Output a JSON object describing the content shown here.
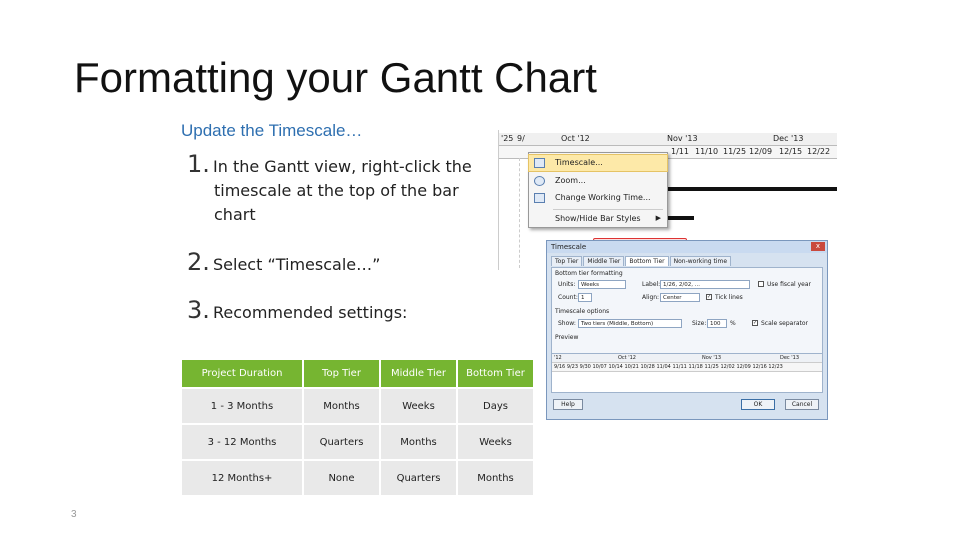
{
  "title": "Formatting your Gantt Chart",
  "subtitle": "Update the Timescale…",
  "steps": [
    {
      "num": "1.",
      "line1": "In the Gantt view, right-click the",
      "line2": "timescale at the top of the bar",
      "line3": "chart"
    },
    {
      "num": "2.",
      "line1": "Select “Timescale…”"
    },
    {
      "num": "3.",
      "line1": "Recommended settings:"
    }
  ],
  "table": {
    "headers": [
      "Project Duration",
      "Top Tier",
      "Middle Tier",
      "Bottom Tier"
    ],
    "rows": [
      [
        "1 - 3 Months",
        "Months",
        "Weeks",
        "Days"
      ],
      [
        "3 -  12 Months",
        "Quarters",
        "Months",
        "Weeks"
      ],
      [
        "12 Months+",
        "None",
        "Quarters",
        "Months"
      ]
    ]
  },
  "page_number": "3",
  "gantt": {
    "top_row": [
      "'25",
      "9/",
      "Oct '12",
      "Nov '13",
      "Dec '13"
    ],
    "bottom_row": [
      "1/11",
      "11/10",
      "11/25",
      "12/09",
      "12/15",
      "12/22"
    ]
  },
  "context_menu": {
    "items": [
      {
        "label": "Timescale...",
        "icon": "timescale-icon"
      },
      {
        "label": "Zoom...",
        "icon": "zoom-icon"
      },
      {
        "label": "Change Working Time...",
        "icon": "calendar-icon"
      },
      {
        "label": "Show/Hide Bar Styles",
        "icon": ""
      }
    ]
  },
  "dialog": {
    "title": "Timescale",
    "close": "x",
    "tabs": [
      "Top Tier",
      "Middle Tier",
      "Bottom Tier",
      "Non-working time"
    ],
    "group_formatting": "Bottom tier formatting",
    "units_label": "Units:",
    "units_value": "Weeks",
    "label_label": "Label:",
    "label_value": "1/26, 2/02, ...",
    "use_fiscal": "Use fiscal year",
    "count_label": "Count:",
    "count_value": "1",
    "align_label": "Align:",
    "align_value": "Center",
    "tick_lines": "Tick lines",
    "group_options": "Timescale options",
    "show_label": "Show:",
    "show_value": "Two tiers (Middle, Bottom)",
    "size_label": "Size:",
    "size_value": "100",
    "pct": "%",
    "scale_separator": "Scale separator",
    "preview_label": "Preview",
    "preview_top": [
      "'12",
      "Oct '12",
      "Nov '13",
      "Dec '13"
    ],
    "preview_bottom": "9/16  9/23  9/30  10/07  10/14  10/21  10/28  11/04  11/11  11/18  11/25  12/02  12/09  12/16  12/23",
    "help_btn": "Help",
    "ok_btn": "OK",
    "cancel_btn": "Cancel"
  }
}
